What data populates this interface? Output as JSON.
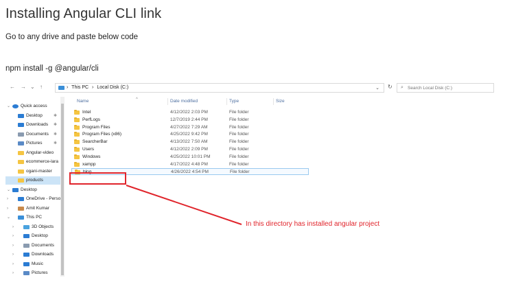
{
  "page": {
    "title": "Installing Angular CLI link",
    "instruction": "Go to any drive and paste below code",
    "command": "npm install -g @angular/cli"
  },
  "explorer": {
    "nav_buttons": [
      "←",
      "→",
      "⌄",
      "↑"
    ],
    "breadcrumbs": [
      "›",
      "This PC",
      "›",
      "Local Disk (C:)"
    ],
    "refresh": "↻",
    "search_placeholder": "Search Local Disk (C:)",
    "nav_pane": [
      {
        "label": "Quick access",
        "chev": "⌄",
        "icon": "star-icon",
        "color": "#2b7cd3",
        "level": 0,
        "pin": false
      },
      {
        "label": "Desktop",
        "chev": "",
        "icon": "desktop-icon",
        "color": "#2b7cd3",
        "level": 1,
        "pin": true
      },
      {
        "label": "Downloads",
        "chev": "",
        "icon": "download-icon",
        "color": "#2b7cd3",
        "level": 1,
        "pin": true
      },
      {
        "label": "Documents",
        "chev": "",
        "icon": "document-icon",
        "color": "#8a9bb0",
        "level": 1,
        "pin": true
      },
      {
        "label": "Pictures",
        "chev": "",
        "icon": "picture-icon",
        "color": "#5a8ac6",
        "level": 1,
        "pin": true
      },
      {
        "label": "Angular-video",
        "chev": "",
        "icon": "folder-icon",
        "color": "#f5c542",
        "level": 1,
        "pin": false
      },
      {
        "label": "ecommerce-lara",
        "chev": "",
        "icon": "folder-icon",
        "color": "#f5c542",
        "level": 1,
        "pin": false
      },
      {
        "label": "ogani-master",
        "chev": "",
        "icon": "folder-icon",
        "color": "#f5c542",
        "level": 1,
        "pin": false
      },
      {
        "label": "products",
        "chev": "",
        "icon": "folder-icon",
        "color": "#f5c542",
        "level": 1,
        "pin": false
      },
      {
        "label": "Desktop",
        "chev": "⌄",
        "icon": "desktop-icon",
        "color": "#2b7cd3",
        "level": 0,
        "pin": false
      },
      {
        "label": "OneDrive - Perso",
        "chev": "›",
        "icon": "cloud-icon",
        "color": "#2b7cd3",
        "level": 1,
        "pin": false
      },
      {
        "label": "Amit Kumar",
        "chev": "›",
        "icon": "user-icon",
        "color": "#c98a4b",
        "level": 1,
        "pin": false
      },
      {
        "label": "This PC",
        "chev": "⌄",
        "icon": "pc-icon",
        "color": "#3a8fd8",
        "level": 1,
        "pin": false
      },
      {
        "label": "3D Objects",
        "chev": "›",
        "icon": "cube-icon",
        "color": "#4aa3df",
        "level": 2,
        "pin": false
      },
      {
        "label": "Desktop",
        "chev": "›",
        "icon": "desktop-icon",
        "color": "#2b7cd3",
        "level": 2,
        "pin": false
      },
      {
        "label": "Documents",
        "chev": "›",
        "icon": "document-icon",
        "color": "#8a9bb0",
        "level": 2,
        "pin": false
      },
      {
        "label": "Downloads",
        "chev": "›",
        "icon": "download-icon",
        "color": "#2b7cd3",
        "level": 2,
        "pin": false
      },
      {
        "label": "Music",
        "chev": "›",
        "icon": "music-icon",
        "color": "#2b7cd3",
        "level": 2,
        "pin": false
      },
      {
        "label": "Pictures",
        "chev": "›",
        "icon": "picture-icon",
        "color": "#5a8ac6",
        "level": 2,
        "pin": false
      }
    ],
    "columns": {
      "name": "Name",
      "date": "Date modified",
      "type": "Type",
      "size": "Size",
      "sort": "^"
    },
    "files": [
      {
        "name": "Intel",
        "date": "4/12/2022 2:03 PM",
        "type": "File folder"
      },
      {
        "name": "PerfLogs",
        "date": "12/7/2019 2:44 PM",
        "type": "File folder"
      },
      {
        "name": "Program Files",
        "date": "4/27/2022 7:29 AM",
        "type": "File folder"
      },
      {
        "name": "Program Files (x86)",
        "date": "4/25/2022 9:42 PM",
        "type": "File folder"
      },
      {
        "name": "SearcherBar",
        "date": "4/13/2022 7:50 AM",
        "type": "File folder"
      },
      {
        "name": "Users",
        "date": "4/12/2022 2:09 PM",
        "type": "File folder"
      },
      {
        "name": "Windows",
        "date": "4/25/2022 10:01 PM",
        "type": "File folder"
      },
      {
        "name": "xampp",
        "date": "4/17/2022 4:48 PM",
        "type": "File folder"
      },
      {
        "name": "blog",
        "date": "4/26/2022 4:54 PM",
        "type": "File folder"
      }
    ],
    "annotation": "In this directory has installed angular project",
    "annotation_color": "#e0242b"
  }
}
